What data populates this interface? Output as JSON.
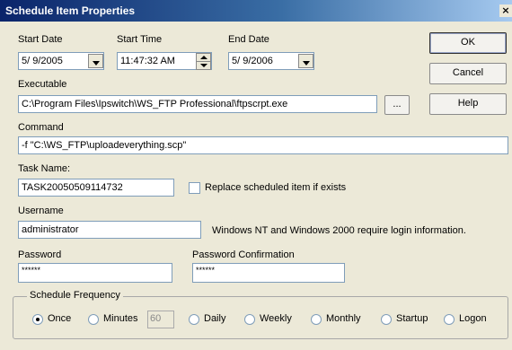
{
  "window": {
    "title": "Schedule Item Properties",
    "close_glyph": "×"
  },
  "start_date": {
    "label": "Start Date",
    "value": "5/  9/2005"
  },
  "start_time": {
    "label": "Start Time",
    "value": "11:47:32 AM"
  },
  "end_date": {
    "label": "End Date",
    "value": "5/  9/2006"
  },
  "executable": {
    "label": "Executable",
    "value": "C:\\Program Files\\Ipswitch\\WS_FTP Professional\\ftpscrpt.exe",
    "browse_label": "..."
  },
  "command": {
    "label": "Command",
    "value": "-f \"C:\\WS_FTP\\uploadeverything.scp\""
  },
  "task_name": {
    "label": "Task Name:",
    "value": "TASK20050509114732"
  },
  "replace": {
    "label": "Replace scheduled item if exists",
    "checked": false
  },
  "username": {
    "label": "Username",
    "value": "administrator",
    "note": "Windows NT and Windows 2000 require login information."
  },
  "password": {
    "label": "Password",
    "value": "******"
  },
  "password_confirm": {
    "label": "Password Confirmation",
    "value": "******"
  },
  "buttons": {
    "ok": "OK",
    "cancel": "Cancel",
    "help": "Help"
  },
  "frequency": {
    "label": "Schedule Frequency",
    "minutes_value": "60",
    "options": [
      {
        "label": "Once",
        "checked": true
      },
      {
        "label": "Minutes",
        "checked": false
      },
      {
        "label": "Daily",
        "checked": false
      },
      {
        "label": "Weekly",
        "checked": false
      },
      {
        "label": "Monthly",
        "checked": false
      },
      {
        "label": "Startup",
        "checked": false
      },
      {
        "label": "Logon",
        "checked": false
      }
    ]
  }
}
